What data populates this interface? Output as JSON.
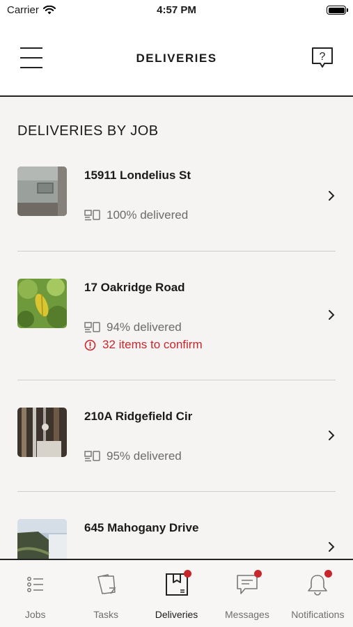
{
  "status_bar": {
    "carrier": "Carrier",
    "time": "4:57 PM",
    "battery_level": 1.0
  },
  "header": {
    "title": "DELIVERIES",
    "menu_icon": "hamburger-menu-icon",
    "help_icon": "help-question-icon"
  },
  "section_title": "DELIVERIES BY JOB",
  "jobs": [
    {
      "name": "15911 Londelius St",
      "progress": "100% delivered",
      "warning": "",
      "thumb": "wall-photo"
    },
    {
      "name": "17 Oakridge Road",
      "progress": "94% delivered",
      "warning": "32 items to confirm",
      "thumb": "leaf-photo"
    },
    {
      "name": "210A Ridgefield Cir",
      "progress": "95% delivered",
      "warning": "",
      "thumb": "pipes-photo"
    },
    {
      "name": "645 Mahogany Drive",
      "progress": "",
      "warning": "",
      "thumb": "waterfall-photo"
    }
  ],
  "tabs": [
    {
      "label": "Jobs",
      "icon": "list-icon",
      "badge": false,
      "active": false
    },
    {
      "label": "Tasks",
      "icon": "notes-icon",
      "badge": false,
      "active": false
    },
    {
      "label": "Deliveries",
      "icon": "package-icon",
      "badge": true,
      "active": true
    },
    {
      "label": "Messages",
      "icon": "chat-icon",
      "badge": true,
      "active": false
    },
    {
      "label": "Notifications",
      "icon": "bell-icon",
      "badge": true,
      "active": false
    }
  ],
  "colors": {
    "accent_red": "#c8262c",
    "background": "#f5f4f2",
    "text_primary": "#1a1a1a",
    "text_secondary": "#6b6b6b"
  }
}
